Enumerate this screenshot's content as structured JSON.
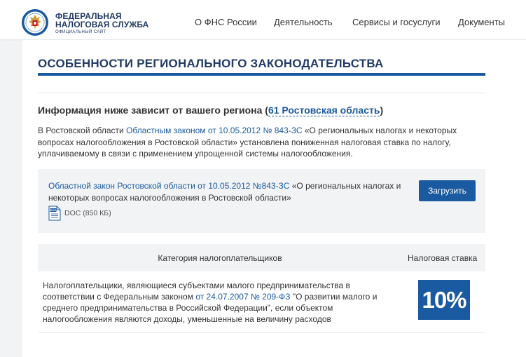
{
  "header": {
    "logo_line1": "ФЕДЕРАЛЬНАЯ",
    "logo_line2": "НАЛОГОВАЯ СЛУЖБА",
    "logo_line3": "ОФИЦИАЛЬНЫЙ САЙТ",
    "nav": [
      "О ФНС России",
      "Деятельность",
      "Сервисы и госуслуги",
      "Документы"
    ]
  },
  "page": {
    "title": "ОСОБЕННОСТИ РЕГИОНАЛЬНОГО ЗАКОНОДАТЕЛЬСТВА",
    "region_heading_prefix": "Информация ниже зависит от вашего региона (",
    "region_link": "61 Ростовская область",
    "region_heading_suffix": ")",
    "intro_prefix": "В Ростовской области ",
    "intro_link": "Областным законом от 10.05.2012 № 843-ЗС",
    "intro_suffix": " «О региональных налогах и некоторых вопросах налогообложения в Ростовской области» установлена пониженная налоговая ставка по налогу, уплачиваемому в связи с применением упрощенной системы налогообложения."
  },
  "document": {
    "link": "Областной закон Ростовской области от 10.05.2012 №843-ЗС",
    "text": " «О региональных налогах и некоторых вопросах налогообложения в Ростовской области»",
    "file_label": "DOC (850 КБ)",
    "icon_text": "DOC",
    "download_label": "Загрузить"
  },
  "table": {
    "col_category": "Категория налогоплательщиков",
    "col_rate": "Налоговая ставка",
    "row_prefix": "Налогоплательщики, являющиеся субъектами малого предпринимательства в соответствии с Федеральным законом ",
    "row_link": "от 24.07.2007 № 209-ФЗ",
    "row_suffix": " \"О развитии малого и среднего предпринимательства в Российской Федерации\", если объектом налогообложения являются доходы, уменьшенные на величину расходов",
    "rate": "10%"
  },
  "colors": {
    "accent": "#1a5aa0",
    "title": "#223b66",
    "panel": "#f2f3f5"
  }
}
